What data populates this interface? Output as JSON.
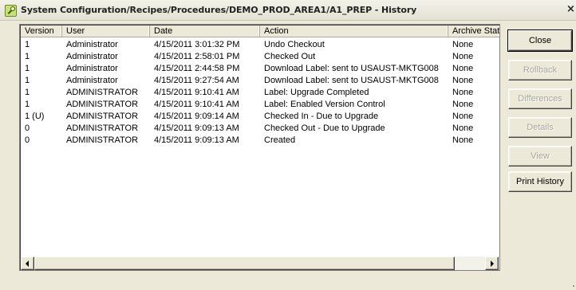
{
  "window": {
    "title": "System Configuration/Recipes/Procedures/DEMO_PROD_AREA1/A1_PREP - History",
    "close_glyph": "×"
  },
  "icons": {
    "app": "recipe-app-icon",
    "close": "close-icon",
    "scroll_left": "scroll-left-arrow-icon",
    "scroll_right": "scroll-right-arrow-icon"
  },
  "table": {
    "columns": [
      "Version",
      "User",
      "Date",
      "Action",
      "Archive Stat"
    ],
    "rows": [
      {
        "version": "1",
        "user": "Administrator",
        "date": "4/15/2011 3:01:32 PM",
        "action": "Undo Checkout",
        "archive": "None"
      },
      {
        "version": "1",
        "user": "Administrator",
        "date": "4/15/2011 2:58:01 PM",
        "action": "Checked Out",
        "archive": "None"
      },
      {
        "version": "1",
        "user": "Administrator",
        "date": "4/15/2011 2:44:58 PM",
        "action": "Download Label: sent to USAUST-MKTG008",
        "archive": "None"
      },
      {
        "version": "1",
        "user": "Administrator",
        "date": "4/15/2011 9:27:54 AM",
        "action": "Download Label: sent to USAUST-MKTG008",
        "archive": "None"
      },
      {
        "version": "1",
        "user": "ADMINISTRATOR",
        "date": "4/15/2011 9:10:41 AM",
        "action": "Label: Upgrade Completed",
        "archive": "None"
      },
      {
        "version": "1",
        "user": "ADMINISTRATOR",
        "date": "4/15/2011 9:10:41 AM",
        "action": "Label: Enabled Version Control",
        "archive": "None"
      },
      {
        "version": "1 (U)",
        "user": "ADMINISTRATOR",
        "date": "4/15/2011 9:09:14 AM",
        "action": "Checked In - Due to Upgrade",
        "archive": "None"
      },
      {
        "version": "0",
        "user": "ADMINISTRATOR",
        "date": "4/15/2011 9:09:13 AM",
        "action": "Checked Out - Due to Upgrade",
        "archive": "None"
      },
      {
        "version": "0",
        "user": "ADMINISTRATOR",
        "date": "4/15/2011 9:09:13 AM",
        "action": "Created",
        "archive": "None"
      }
    ]
  },
  "buttons": {
    "close": "Close",
    "rollback": "Rollback",
    "differences": "Differences",
    "details": "Details",
    "view": "View",
    "print_history": "Print History"
  },
  "colors": {
    "window_bg": "#ece9d8",
    "disabled_text": "#a7a69b"
  }
}
